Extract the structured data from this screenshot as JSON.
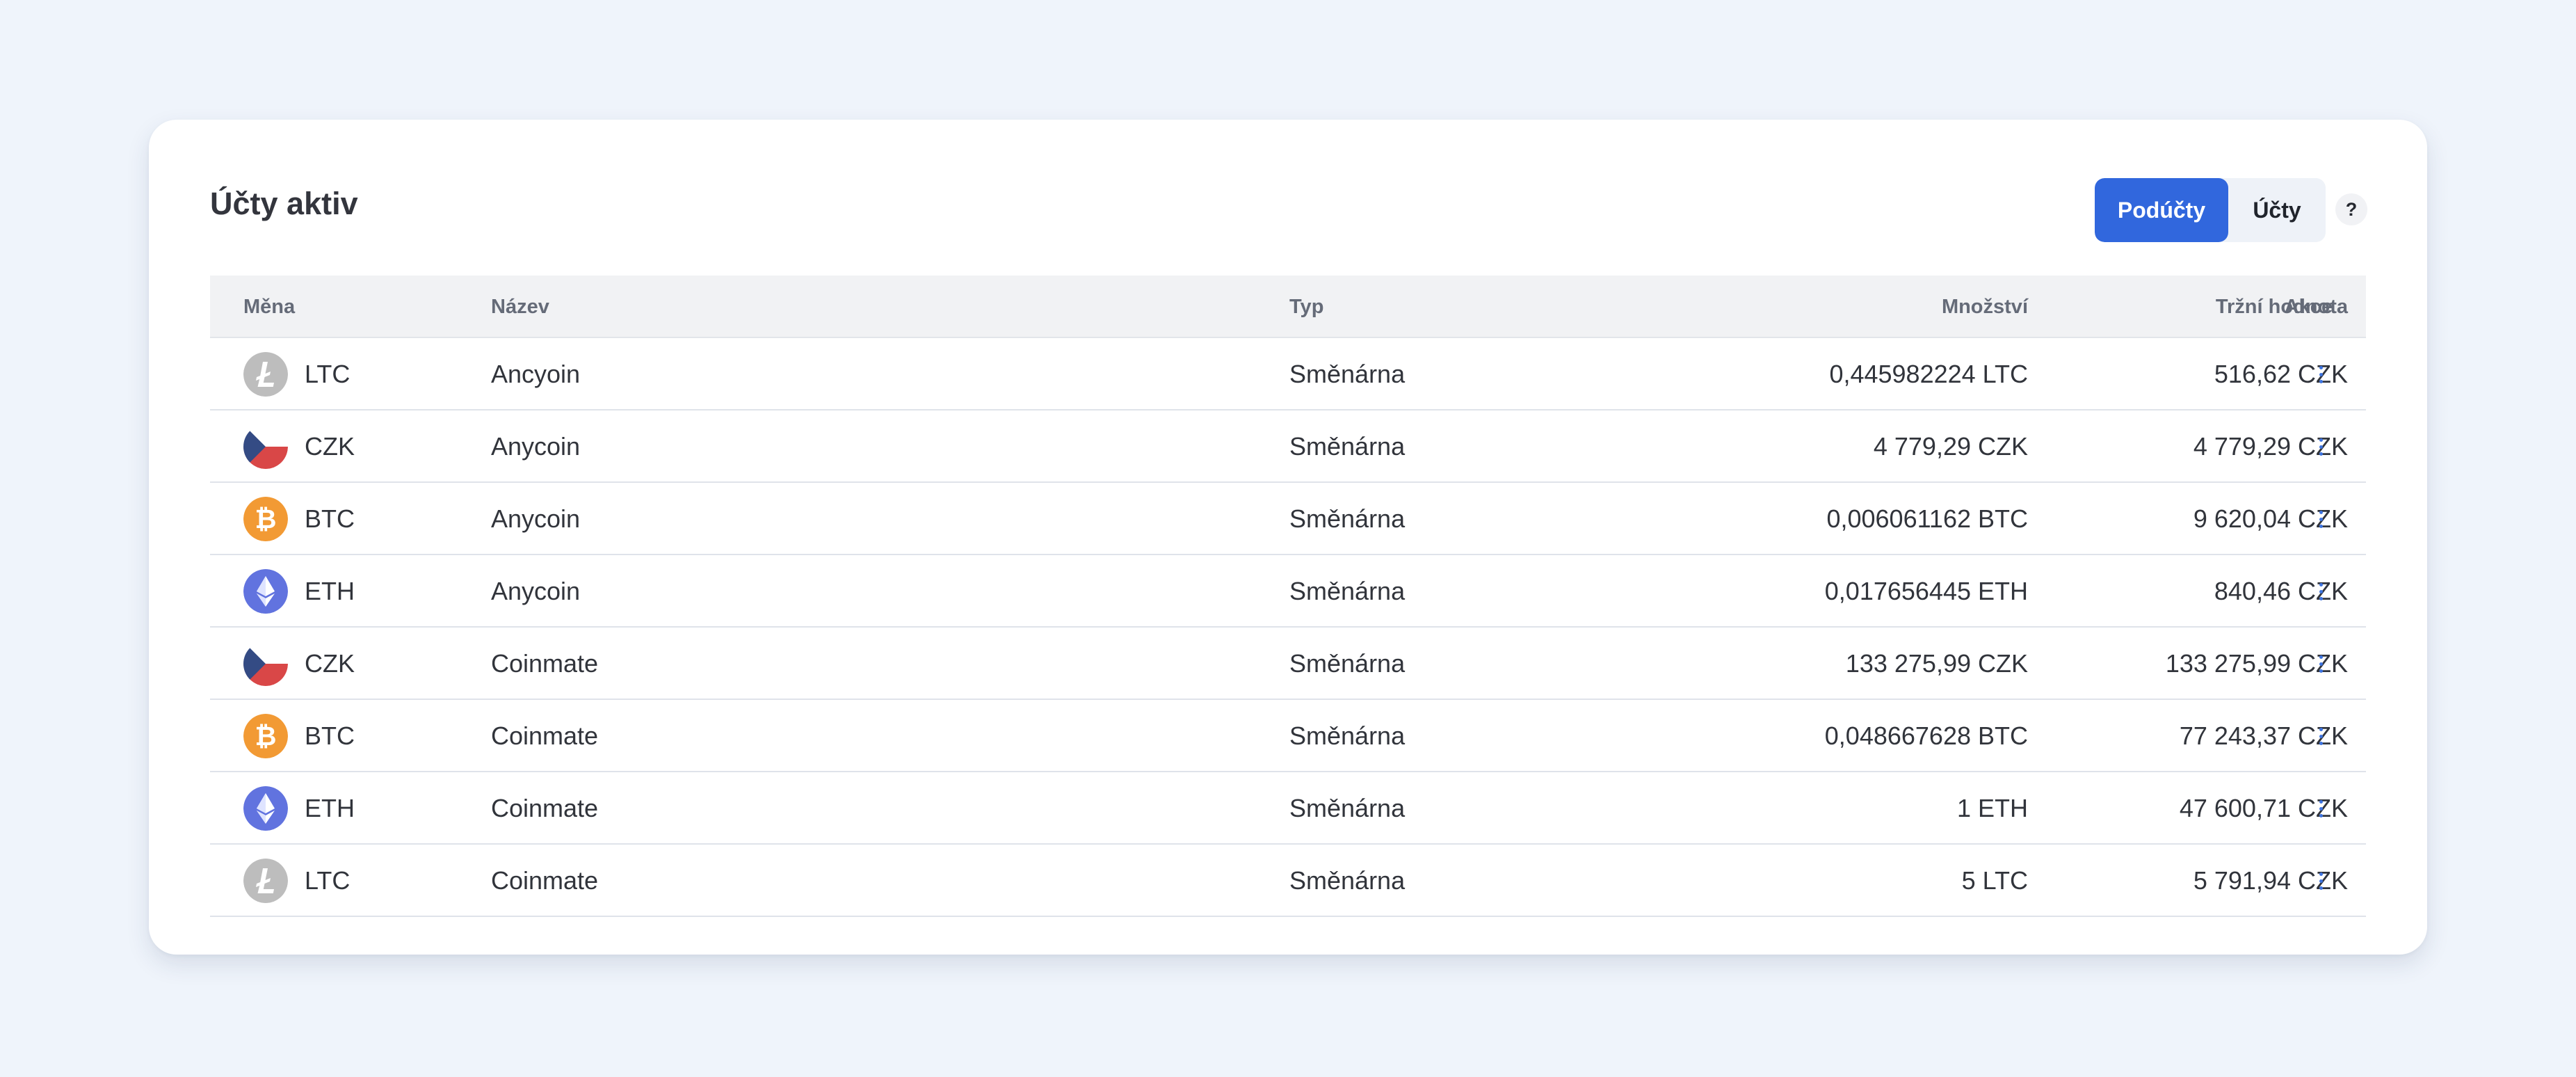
{
  "panel": {
    "title": "Účty aktiv",
    "toggle": {
      "active_label": "Podúčty",
      "inactive_label": "Účty"
    },
    "help_label": "?"
  },
  "table": {
    "headers": {
      "currency": "Měna",
      "name": "Název",
      "type": "Typ",
      "quantity": "Množství",
      "market_value": "Tržní hodnota",
      "actions": "Akce"
    },
    "rows": [
      {
        "icon": "litecoin-icon",
        "currency": "LTC",
        "name": "Ancyoin",
        "type": "Směnárna",
        "quantity": "0,445982224 LTC",
        "market_value": "516,62 CZK"
      },
      {
        "icon": "czech-flag-icon",
        "currency": "CZK",
        "name": "Anycoin",
        "type": "Směnárna",
        "quantity": "4 779,29 CZK",
        "market_value": "4 779,29 CZK"
      },
      {
        "icon": "bitcoin-icon",
        "currency": "BTC",
        "name": "Anycoin",
        "type": "Směnárna",
        "quantity": "0,006061162 BTC",
        "market_value": "9 620,04 CZK"
      },
      {
        "icon": "ethereum-icon",
        "currency": "ETH",
        "name": "Anycoin",
        "type": "Směnárna",
        "quantity": "0,017656445 ETH",
        "market_value": "840,46 CZK"
      },
      {
        "icon": "czech-flag-icon",
        "currency": "CZK",
        "name": "Coinmate",
        "type": "Směnárna",
        "quantity": "133 275,99 CZK",
        "market_value": "133 275,99 CZK"
      },
      {
        "icon": "bitcoin-icon",
        "currency": "BTC",
        "name": "Coinmate",
        "type": "Směnárna",
        "quantity": "0,048667628 BTC",
        "market_value": "77 243,37 CZK"
      },
      {
        "icon": "ethereum-icon",
        "currency": "ETH",
        "name": "Coinmate",
        "type": "Směnárna",
        "quantity": "1 ETH",
        "market_value": "47 600,71 CZK"
      },
      {
        "icon": "litecoin-icon",
        "currency": "LTC",
        "name": "Coinmate",
        "type": "Směnárna",
        "quantity": "5 LTC",
        "market_value": "5 791,94 CZK"
      }
    ]
  },
  "colors": {
    "background": "#eff4fb",
    "accent": "#3167dd",
    "action_dots": "#3d73df",
    "litecoin": "#bdbdbd",
    "bitcoin": "#f29a34",
    "ethereum": "#6173df",
    "czech_blue": "#344b84",
    "czech_red": "#d94747"
  }
}
